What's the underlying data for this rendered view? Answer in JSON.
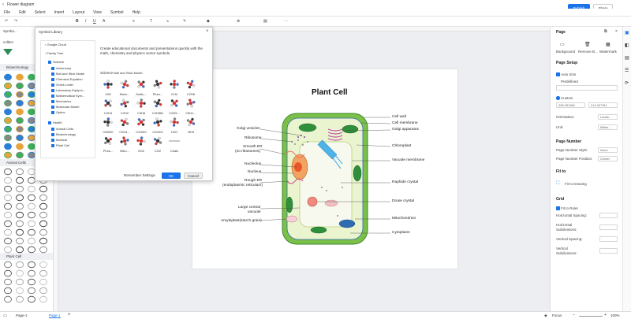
{
  "app": {
    "doc_title": "Flower diagram",
    "publish": "Publish",
    "share": "Share",
    "menu": [
      "File",
      "Edit",
      "Select",
      "Insert",
      "Layout",
      "View",
      "Symbol",
      "Help"
    ]
  },
  "left_panel": {
    "header": "Symbo...",
    "collect": "collect",
    "sections": [
      "Biotechnology",
      "Animal Cells",
      "Plant Cell"
    ]
  },
  "dialog": {
    "title": "Symbol Library",
    "tree": [
      "Google Cloud",
      "Family Tree",
      "Science",
      "Astronomy",
      "Ball and Stick Model",
      "Chemical Equation",
      "Greek Letter",
      "Laboratory Equipm...",
      "Mathematical Sym...",
      "Mechanics",
      "Molecular Model",
      "Optics",
      "Health",
      "Animal Cells",
      "Biotechnology",
      "Medical",
      "Plant Cell"
    ],
    "description": "Create educational documents and presentations quickly with the math, chemistry and physics vector symbols.",
    "category": "Science",
    "subcategory": "Ball and Stick Model",
    "symbols": [
      "C60",
      "Diam...",
      "Sodiu...",
      "Plum...",
      "CH4",
      "C2H6",
      "C2H4",
      "C2H2",
      "C3H6",
      "C2H5Br",
      "C2H5...",
      "C6H1...",
      "C6H6O",
      "C2H4...",
      "C2H6O",
      "C2H4O",
      "H2O",
      "NH3",
      "Phos...",
      "Nitro...",
      "SO2",
      "CO2",
      "Chain"
    ],
    "remember": "Remember Settings",
    "ok": "OK",
    "cancel": "Cancel"
  },
  "diagram": {
    "title": "Plant Cell",
    "left_labels": [
      "Golgi vesicles",
      "Ribosome",
      "Smooth ER",
      "(no ribosomes)",
      "Nucleolus",
      "Nucleus",
      "Rough ER",
      "(endoplasmic reticulum)",
      "Large central",
      "vacuole",
      "Amyloplast(starch grain)"
    ],
    "right_labels": [
      "Cell wall",
      "Cell membrane",
      "Golgi apparatus",
      "Chloroplast",
      "Vacuole membrane",
      "Raphide crystal",
      "Druse crystal",
      "Mitochondrion",
      "Cytoplasm"
    ]
  },
  "right_panel": {
    "tab": "Page",
    "tools": [
      "Background",
      "Remove B...",
      "Watermark"
    ],
    "page_setup": "Page Setup",
    "auto_size": "Auto Size",
    "predefined": "Predefined",
    "custom": "Custom",
    "width_val": "296.991661",
    "height_val": "214.347911",
    "orientation_label": "Orientation:",
    "orientation_val": "Lands...",
    "unit_label": "Unit:",
    "unit_val": "Millim...",
    "page_number": "Page Number",
    "pn_style_label": "Page Number Style:",
    "pn_style_val": "None",
    "pn_pos_label": "Page Number Position:",
    "pn_pos_val": "Center",
    "fit_to": "Fit to",
    "fit_drawing": "Fit to Drawing",
    "grid": "Grid",
    "fit_ruler": "Fit to Ruler",
    "h_spacing": "Horizontal Spacing:",
    "h_sub": "Horizontal",
    "h_sub2": "Subdivisions:",
    "v_spacing": "Vertical Spacing:",
    "v_sub": "Vertical",
    "v_sub2": "Subdivisions:"
  },
  "status": {
    "page_tab": "Page-1",
    "active_tab": "Page-1",
    "focus": "Focus",
    "zoom": "100%"
  }
}
